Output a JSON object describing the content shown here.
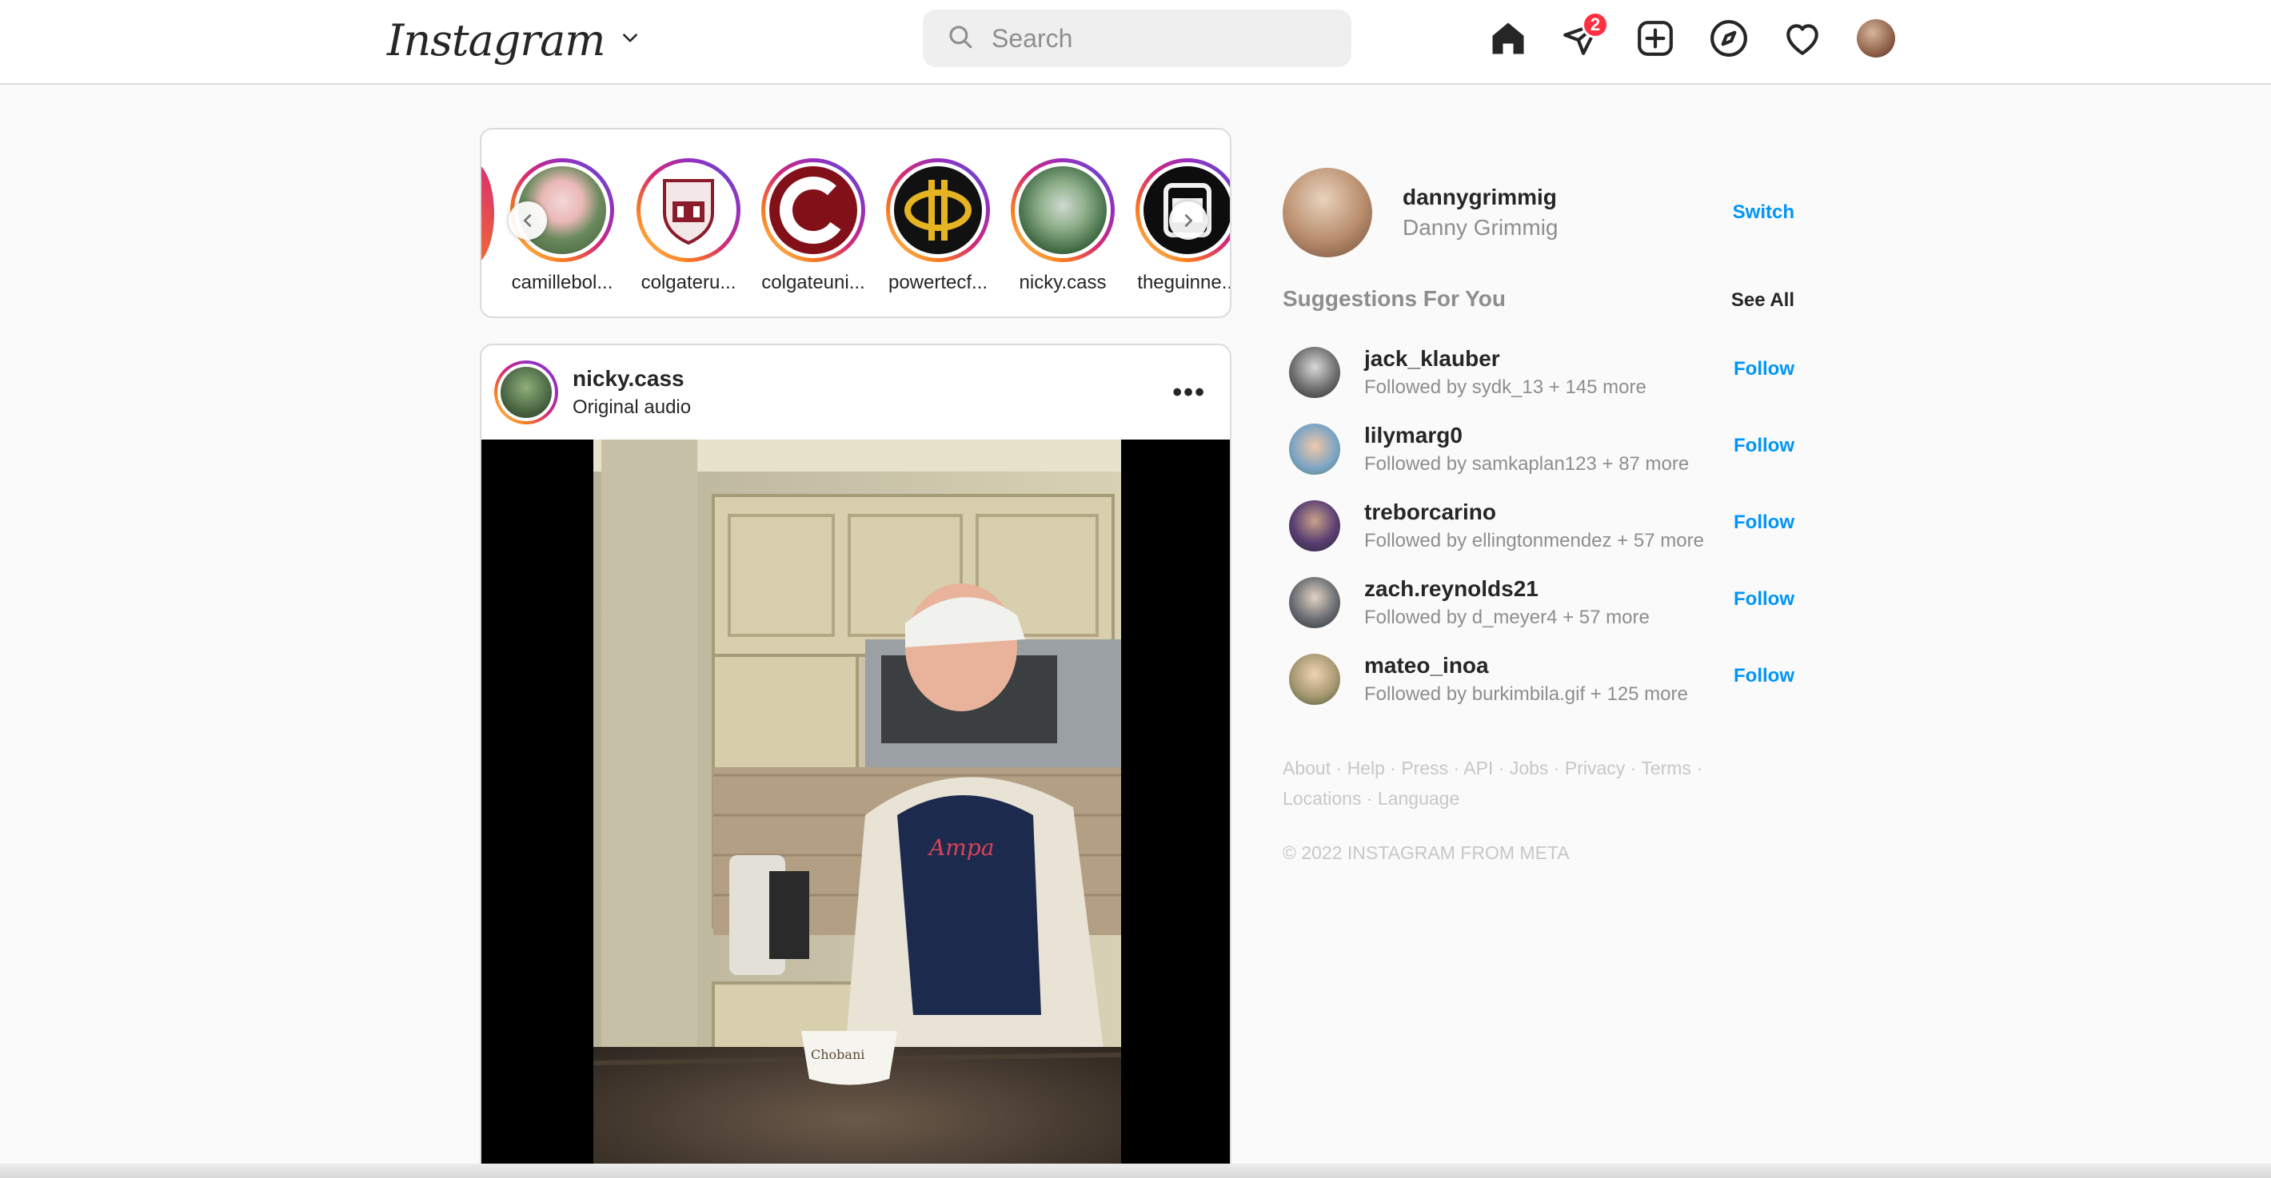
{
  "header": {
    "logo": "Instagram",
    "search_placeholder": "Search",
    "messages_badge": "2",
    "icons": [
      "home-icon",
      "direct-messages-icon",
      "new-post-icon",
      "explore-icon",
      "activity-heart-icon",
      "profile-avatar"
    ]
  },
  "stories": {
    "items": [
      {
        "label": "camillebol..."
      },
      {
        "label": "colgateru..."
      },
      {
        "label": "colgateuni..."
      },
      {
        "label": "powertecf..."
      },
      {
        "label": "nicky.cass"
      },
      {
        "label": "theguinne..."
      }
    ]
  },
  "post": {
    "username": "nicky.cass",
    "audio": "Original audio",
    "more": "•••",
    "cup_text": "Chobani"
  },
  "sidebar": {
    "username": "dannygrimmig",
    "fullname": "Danny Grimmig",
    "switch_label": "Switch",
    "suggestions_title": "Suggestions For You",
    "see_all": "See All",
    "follow_label": "Follow",
    "suggestions": [
      {
        "username": "jack_klauber",
        "subtitle": "Followed by sydk_13 + 145 more"
      },
      {
        "username": "lilymarg0",
        "subtitle": "Followed by samkaplan123 + 87 more"
      },
      {
        "username": "treborcarino",
        "subtitle": "Followed by ellingtonmendez + 57 more"
      },
      {
        "username": "zach.reynolds21",
        "subtitle": "Followed by d_meyer4 + 57 more"
      },
      {
        "username": "mateo_inoa",
        "subtitle": "Followed by burkimbila.gif + 125 more"
      }
    ],
    "footer_links": [
      "About",
      "Help",
      "Press",
      "API",
      "Jobs",
      "Privacy",
      "Terms",
      "Locations",
      "Language"
    ],
    "copyright": "© 2022 INSTAGRAM FROM META"
  },
  "colors": {
    "accent": "#0095f6",
    "badge": "#ff3040",
    "border": "#dbdbdb",
    "muted": "#8e8e8e"
  }
}
